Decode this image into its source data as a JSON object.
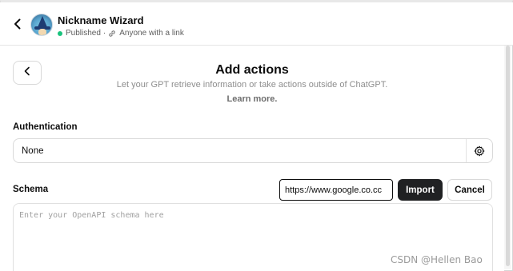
{
  "header": {
    "title": "Nickname Wizard",
    "status": "Published",
    "separator": "·",
    "visibility": "Anyone with a link"
  },
  "panel": {
    "heading": "Add actions",
    "description": "Let your GPT retrieve information or take actions outside of ChatGPT.",
    "learn_more": "Learn more."
  },
  "authentication": {
    "label": "Authentication",
    "value": "None"
  },
  "schema": {
    "label": "Schema",
    "url_value": "https://www.google.co.cc",
    "import_label": "Import",
    "cancel_label": "Cancel",
    "placeholder": "Enter your OpenAPI schema here"
  },
  "watermark": "CSDN @Hellen Bao",
  "colors": {
    "published_dot": "#19c37d",
    "primary_button": "#202123",
    "muted_text": "#8e8e8e"
  },
  "icons": {
    "back": "chevron-left-icon",
    "link": "link-icon",
    "settings": "gear-icon"
  }
}
